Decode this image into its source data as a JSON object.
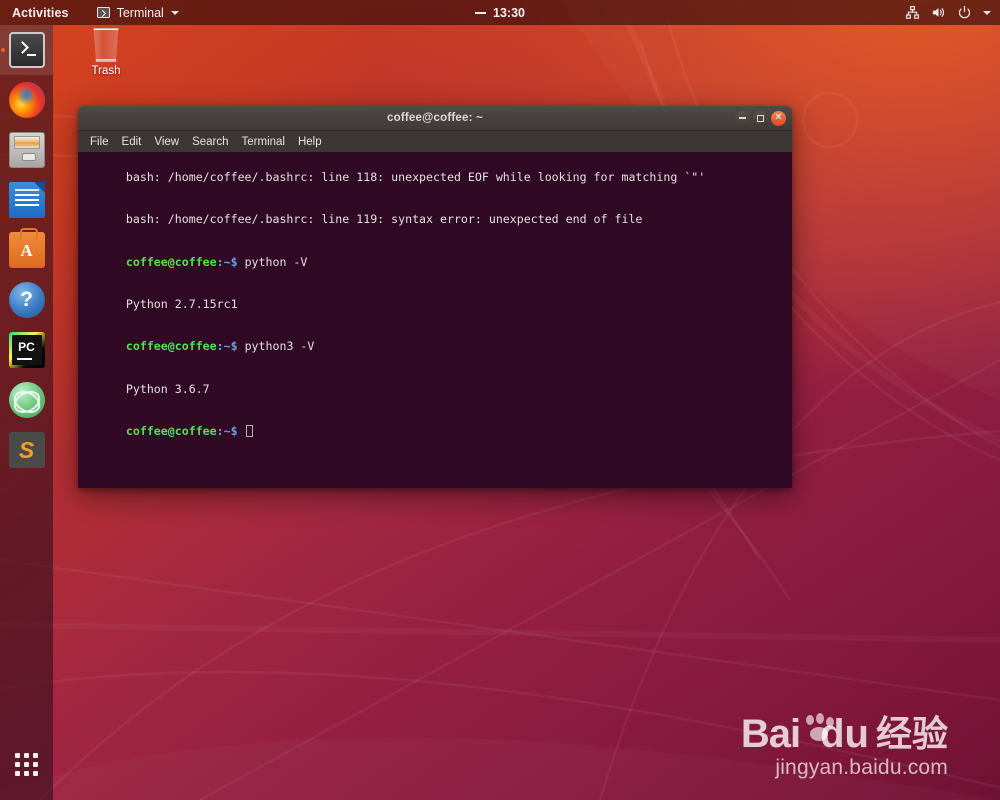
{
  "topbar": {
    "activities_label": "Activities",
    "app_menu_label": "Terminal",
    "app_menu_icon": "terminal-mini-icon",
    "clock": "13:30",
    "clock_prefix_icon": "dash-icon",
    "tray_icons": [
      "network-icon",
      "volume-icon",
      "power-icon",
      "chevron-down-icon"
    ]
  },
  "launcher": {
    "items": [
      {
        "name": "terminal",
        "label": "Terminal",
        "running": true
      },
      {
        "name": "firefox",
        "label": "Firefox Web Browser",
        "running": false
      },
      {
        "name": "files",
        "label": "Files",
        "running": false
      },
      {
        "name": "writer",
        "label": "LibreOffice Writer",
        "running": false
      },
      {
        "name": "software",
        "label": "Ubuntu Software",
        "running": false
      },
      {
        "name": "help",
        "label": "Help",
        "running": false
      },
      {
        "name": "pycharm",
        "label": "PyCharm",
        "running": false
      },
      {
        "name": "atom",
        "label": "Atom",
        "running": false
      },
      {
        "name": "sublime",
        "label": "Sublime Text",
        "running": false
      }
    ],
    "show_apps_label": "Show Applications"
  },
  "desktop": {
    "trash_label": "Trash",
    "trash_icon": "trash-icon"
  },
  "terminal": {
    "title": "coffee@coffee: ~",
    "menu": [
      "File",
      "Edit",
      "View",
      "Search",
      "Terminal",
      "Help"
    ],
    "window_buttons": {
      "minimize": "minimize-button",
      "maximize": "maximize-button",
      "close": "close-button"
    },
    "lines": [
      {
        "type": "output",
        "text": "bash: /home/coffee/.bashrc: line 118: unexpected EOF while looking for matching `\"'"
      },
      {
        "type": "output",
        "text": "bash: /home/coffee/.bashrc: line 119: syntax error: unexpected end of file"
      },
      {
        "type": "prompt",
        "user": "coffee@coffee",
        "path": ":~$",
        "command": " python -V"
      },
      {
        "type": "output",
        "text": "Python 2.7.15rc1"
      },
      {
        "type": "prompt",
        "user": "coffee@coffee",
        "path": ":~$",
        "command": " python3 -V"
      },
      {
        "type": "output",
        "text": "Python 3.6.7"
      },
      {
        "type": "prompt",
        "user": "coffee@coffee",
        "path": ":~$",
        "command": " ",
        "cursor": true
      }
    ],
    "colors": {
      "background": "#300a24",
      "foreground": "#e4dfe0",
      "prompt_user": "#4ee44e",
      "prompt_path": "#6a9fe0",
      "titlebar": "#45403d"
    }
  },
  "watermark": {
    "bai": "Bai",
    "du": "du",
    "chinese": "经验",
    "url": "jingyan.baidu.com"
  }
}
